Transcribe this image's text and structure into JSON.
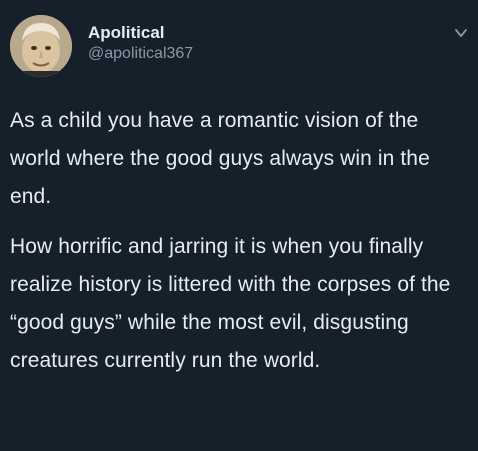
{
  "tweet": {
    "author": {
      "display_name": "Apolitical",
      "handle": "@apolitical367"
    },
    "paragraphs": [
      "As a child you have a romantic vision of the world where the good guys always win in the end.",
      "How horrific and jarring it is when you finally realize history is littered with the corpses of the “good guys” while the most evil, disgusting creatures currently run the world."
    ],
    "icons": {
      "avatar": "avatar-portrait",
      "menu": "chevron-down-icon"
    }
  },
  "colors": {
    "background": "#15202b",
    "text_primary": "#e7ecef",
    "text_secondary": "#8b98a5"
  }
}
